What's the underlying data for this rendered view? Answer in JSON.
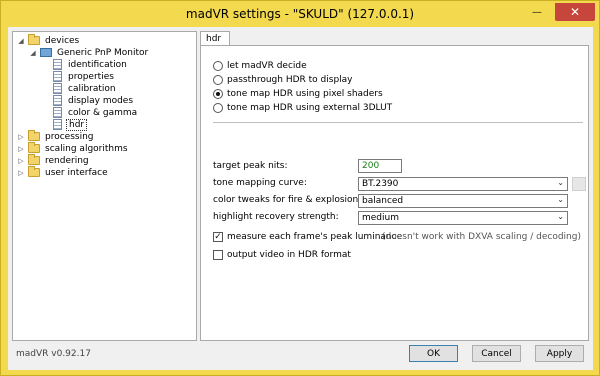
{
  "window": {
    "title": "madVR settings - \"SKULD\" (127.0.0.1)",
    "minimize_glyph": "—",
    "close_glyph": "✕"
  },
  "tree": {
    "devices": "devices",
    "monitor": "Generic PnP Monitor",
    "items": [
      "identification",
      "properties",
      "calibration",
      "display modes",
      "color & gamma",
      "hdr"
    ],
    "groups": [
      "processing",
      "scaling algorithms",
      "rendering",
      "user interface"
    ],
    "selected": "hdr"
  },
  "tab": {
    "label": "hdr"
  },
  "hdr": {
    "options": [
      "let madVR decide",
      "passthrough HDR to display",
      "tone map HDR using pixel shaders",
      "tone map HDR using external 3DLUT"
    ],
    "selected_option": "tone map HDR using pixel shaders",
    "target_peak_label": "target peak nits:",
    "target_peak_value": "200",
    "curve_label": "tone mapping curve:",
    "curve_value": "BT.2390",
    "fire_label": "color tweaks for fire & explosions:",
    "fire_value": "balanced",
    "highlight_label": "highlight recovery strength:",
    "highlight_value": "medium",
    "measure_label": "measure each frame's peak luminance",
    "measure_checked": true,
    "measure_note": "(doesn't work with DXVA scaling / decoding)",
    "output_hdr_label": "output video in HDR format",
    "output_hdr_checked": false
  },
  "footer": {
    "version": "madVR v0.92.17",
    "ok": "OK",
    "cancel": "Cancel",
    "apply": "Apply"
  },
  "colors": {
    "titlebar": "#f2d94d",
    "close_button": "#c7463b",
    "value_text": "#1a7f1a"
  }
}
